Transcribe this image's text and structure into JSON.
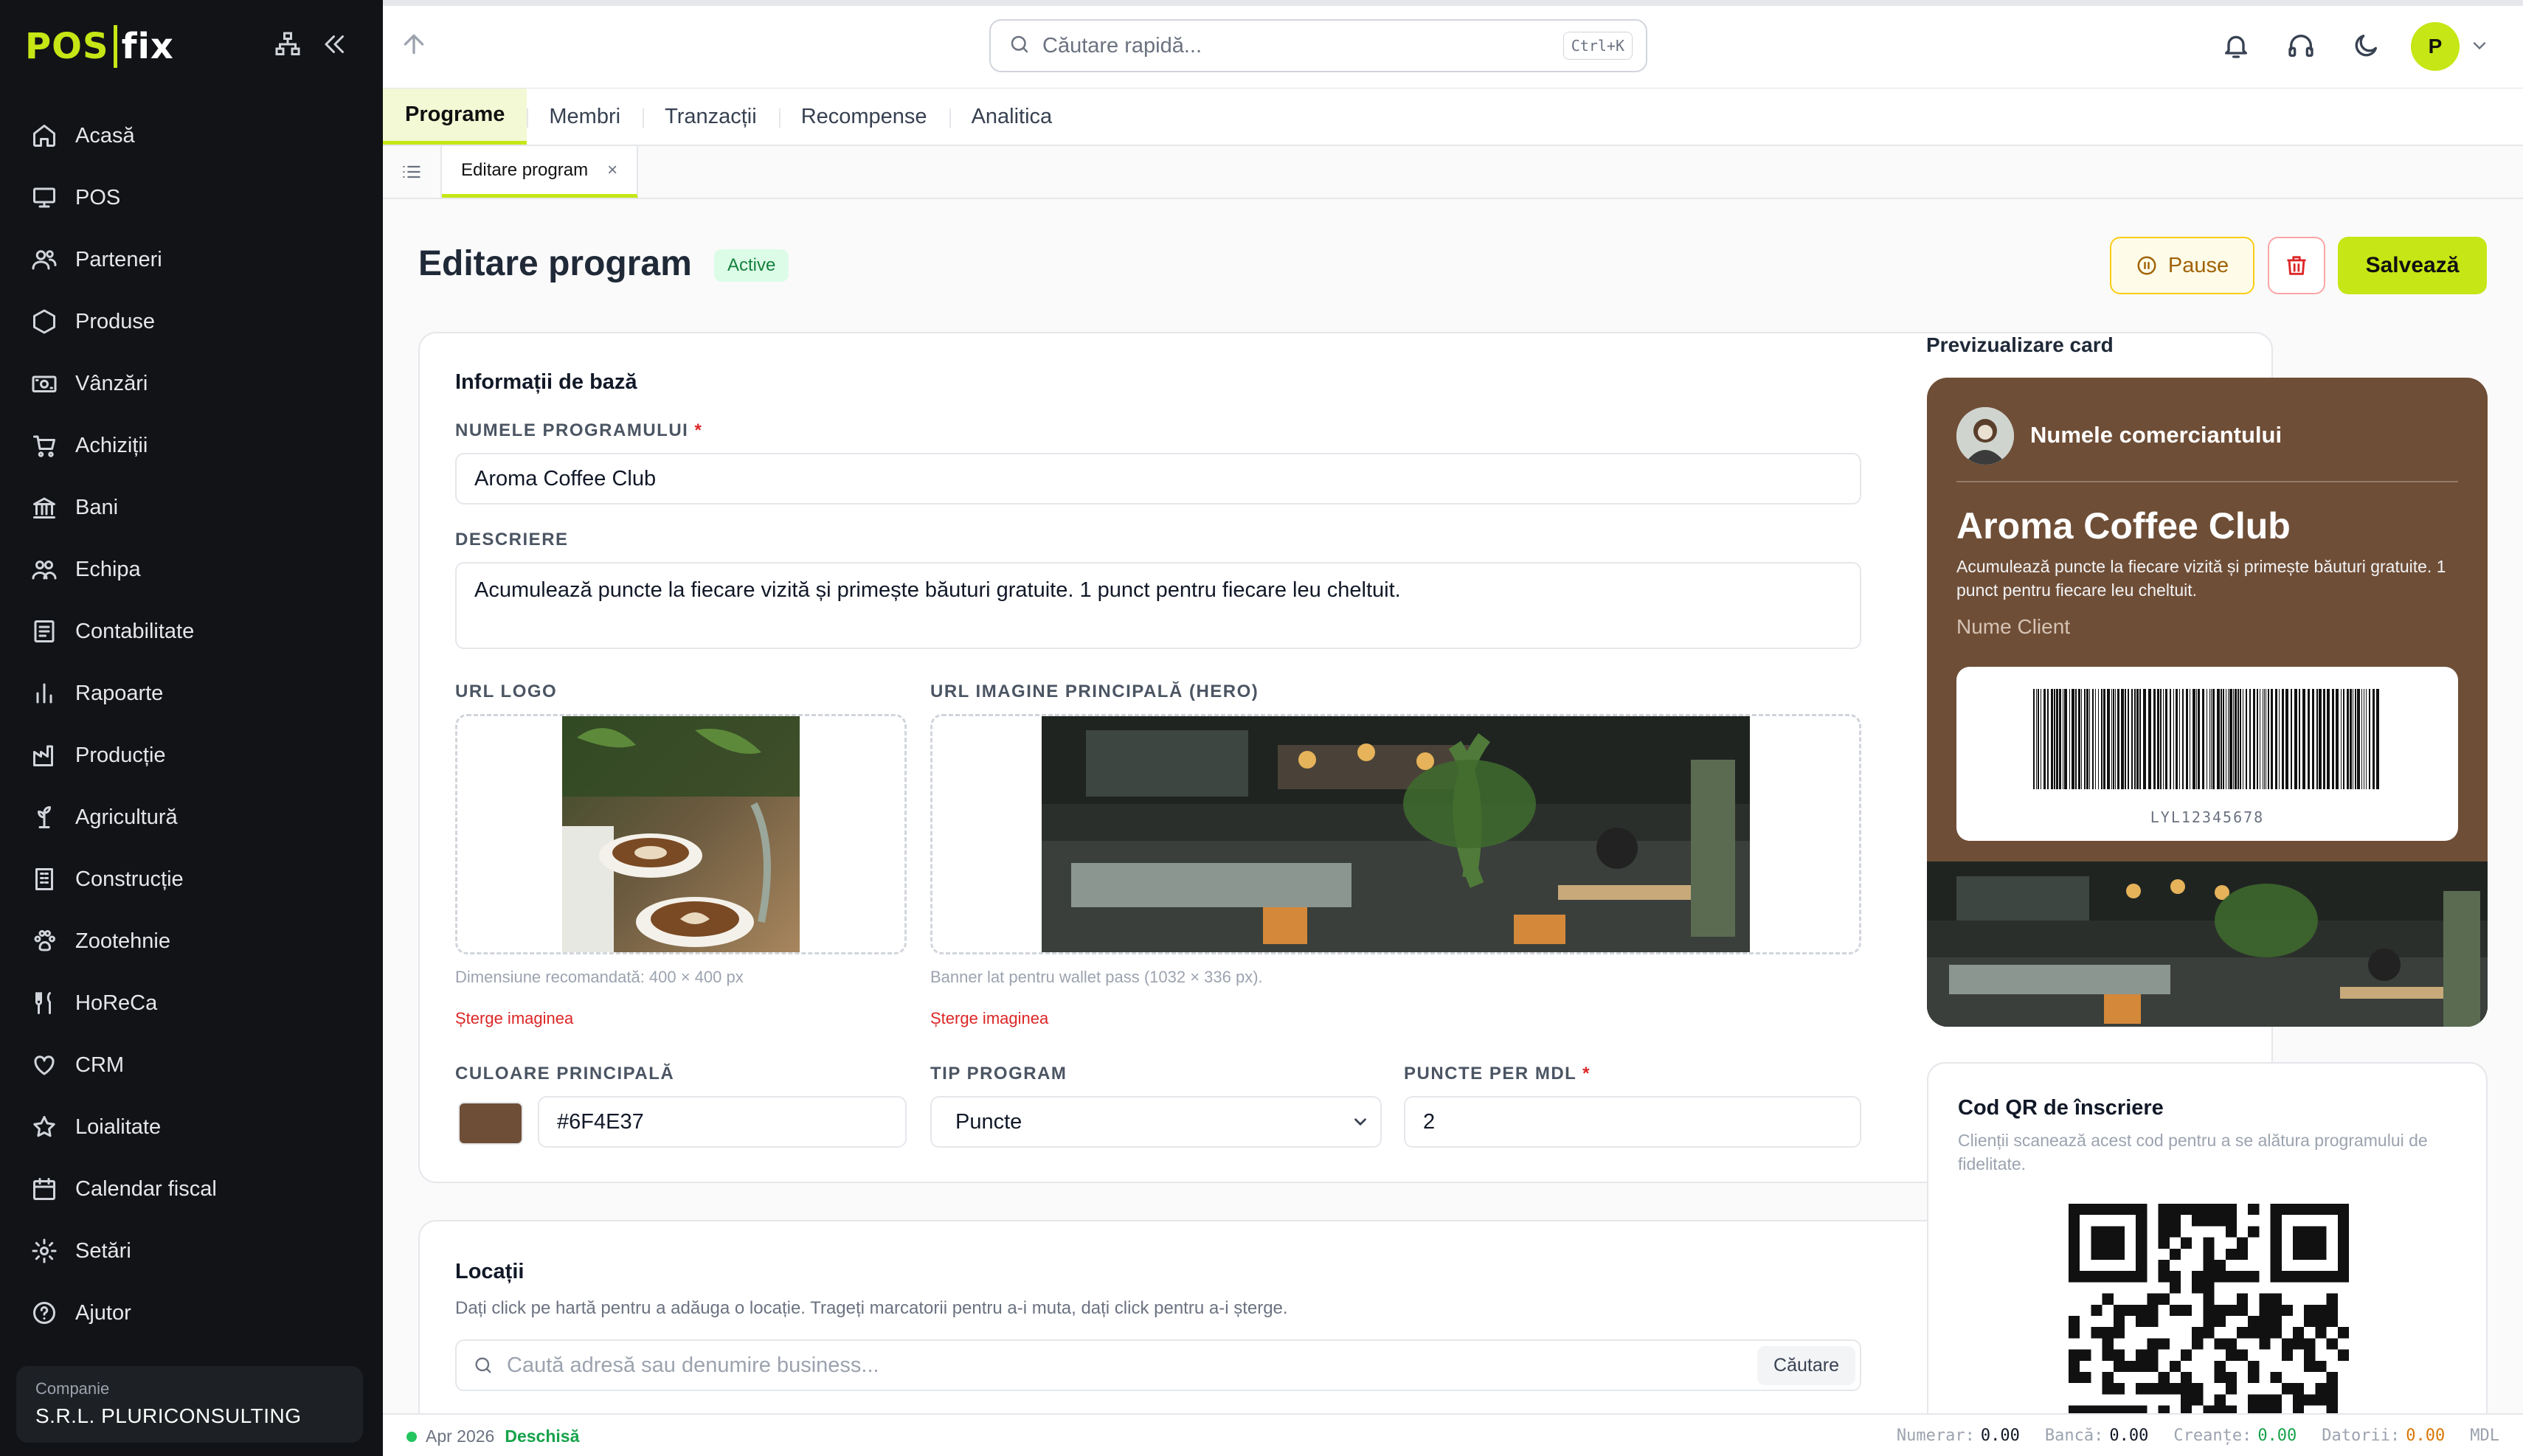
{
  "brand": {
    "logo_left": "POS",
    "logo_right": "fix",
    "accent": "#c6e615"
  },
  "sidebar": {
    "items": [
      {
        "label": "Acasă",
        "icon": "home-icon"
      },
      {
        "label": "POS",
        "icon": "monitor-icon"
      },
      {
        "label": "Parteneri",
        "icon": "users-icon"
      },
      {
        "label": "Produse",
        "icon": "hexagon-icon"
      },
      {
        "label": "Vânzări",
        "icon": "cash-icon"
      },
      {
        "label": "Achiziții",
        "icon": "cart-icon"
      },
      {
        "label": "Bani",
        "icon": "bank-icon"
      },
      {
        "label": "Echipa",
        "icon": "team-icon"
      },
      {
        "label": "Contabilitate",
        "icon": "ledger-icon"
      },
      {
        "label": "Rapoarte",
        "icon": "bar-chart-icon"
      },
      {
        "label": "Producție",
        "icon": "factory-icon"
      },
      {
        "label": "Agricultură",
        "icon": "plant-icon"
      },
      {
        "label": "Construcție",
        "icon": "building-icon"
      },
      {
        "label": "Zootehnie",
        "icon": "paw-icon"
      },
      {
        "label": "HoReCa",
        "icon": "utensils-icon"
      },
      {
        "label": "CRM",
        "icon": "heart-icon"
      },
      {
        "label": "Loialitate",
        "icon": "star-icon"
      },
      {
        "label": "Calendar fiscal",
        "icon": "calendar-icon"
      },
      {
        "label": "Setări",
        "icon": "gear-icon"
      },
      {
        "label": "Ajutor",
        "icon": "help-icon"
      }
    ],
    "company": {
      "label": "Companie",
      "name": "S.R.L. PLURICONSULTING"
    }
  },
  "topbar": {
    "search_placeholder": "Căutare rapidă...",
    "shortcut": "Ctrl+K",
    "avatar_initial": "P"
  },
  "tabs": [
    {
      "label": "Programe",
      "active": true
    },
    {
      "label": "Membri",
      "active": false
    },
    {
      "label": "Tranzacții",
      "active": false
    },
    {
      "label": "Recompense",
      "active": false
    },
    {
      "label": "Analitica",
      "active": false
    }
  ],
  "subtab": {
    "label": "Editare program",
    "close": "×"
  },
  "page": {
    "title": "Editare program",
    "status": "Active",
    "pause_label": "Pause",
    "save_label": "Salvează"
  },
  "basic": {
    "section_title": "Informații de bază",
    "name_label": "NUMELE PROGRAMULUI",
    "name_value": "Aroma Coffee Club",
    "desc_label": "DESCRIERE",
    "desc_value": "Acumulează puncte la fiecare vizită și primește băuturi gratuite. 1 punct pentru fiecare leu cheltuit.",
    "logo_label": "URL LOGO",
    "logo_hint": "Dimensiune recomandată: 400 × 400 px",
    "logo_delete": "Șterge imaginea",
    "hero_label": "URL IMAGINE PRINCIPALĂ (HERO)",
    "hero_hint": "Banner lat pentru wallet pass (1032 × 336 px).",
    "hero_delete": "Șterge imaginea",
    "color_label": "CULOARE PRINCIPALĂ",
    "color_value": "#6F4E37",
    "type_label": "TIP PROGRAM",
    "type_value": "Puncte",
    "points_label": "PUNCTE PER MDL",
    "points_value": "2",
    "required_mark": "*"
  },
  "locations": {
    "section_title": "Locații",
    "help": "Dați click pe hartă pentru a adăuga o locație. Trageți marcatorii pentru a-i muta, dați click pentru a-i șterge.",
    "search_placeholder": "Caută adresă sau denumire business...",
    "search_button": "Căutare"
  },
  "preview": {
    "label": "Previzualizare card",
    "merchant": "Numele comerciantului",
    "title": "Aroma Coffee Club",
    "description": "Acumulează puncte la fiecare vizită și primește băuturi gratuite. 1 punct pentru fiecare leu cheltuit.",
    "client": "Nume Client",
    "code": "LYL12345678",
    "card_color": "#6F4E37"
  },
  "qr": {
    "title": "Cod QR de înscriere",
    "description": "Clienții scanează acest cod pentru a se alătura programului de fidelitate."
  },
  "status": {
    "period": "Apr 2026",
    "state": "Deschisă",
    "numerar_label": "Numerar:",
    "numerar": "0.00",
    "banca_label": "Bancă:",
    "banca": "0.00",
    "creante_label": "Creanțe:",
    "creante": "0.00",
    "datorii_label": "Datorii:",
    "datorii": "0.00",
    "currency": "MDL"
  }
}
